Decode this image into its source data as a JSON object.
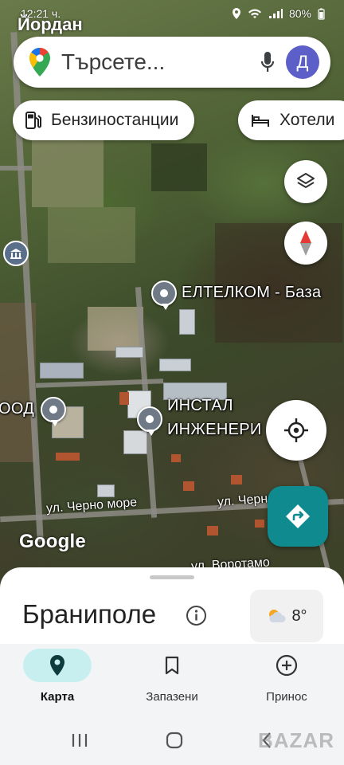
{
  "status_bar": {
    "time": "12:21 ч.",
    "battery": "80%"
  },
  "user_overlay": "Йордан",
  "search": {
    "placeholder": "Търсете...",
    "avatar_letter": "Д"
  },
  "chips": [
    {
      "label": "Бензиностанции",
      "icon": "gas-station-icon"
    },
    {
      "label": "Хотели",
      "icon": "bed-icon"
    }
  ],
  "map": {
    "poi_labels": [
      "ЕЛТЕЛКОМ - База",
      "ООД",
      "ИНСТАЛ",
      "ИНЖЕНЕРИ"
    ],
    "street_labels": [
      "ул. Черно море",
      "ул. Черно море",
      "ул. Воротамо"
    ],
    "google_logo": "Google",
    "compass_icon": "compass-icon",
    "layers_icon": "layers-icon"
  },
  "place": {
    "title": "Браниполе",
    "weather_temp": "8°",
    "weather_icon": "partly-cloudy-icon"
  },
  "bottom_nav": [
    {
      "label": "Карта",
      "icon": "map-pin-icon",
      "active": true
    },
    {
      "label": "Запазени",
      "icon": "bookmark-icon",
      "active": false
    },
    {
      "label": "Принос",
      "icon": "add-circle-icon",
      "active": false
    }
  ],
  "colors": {
    "accent_teal": "#0f8a8f",
    "avatar": "#5b5fc7",
    "nav_active": "#c7eff0"
  },
  "watermark": "BAZAR"
}
